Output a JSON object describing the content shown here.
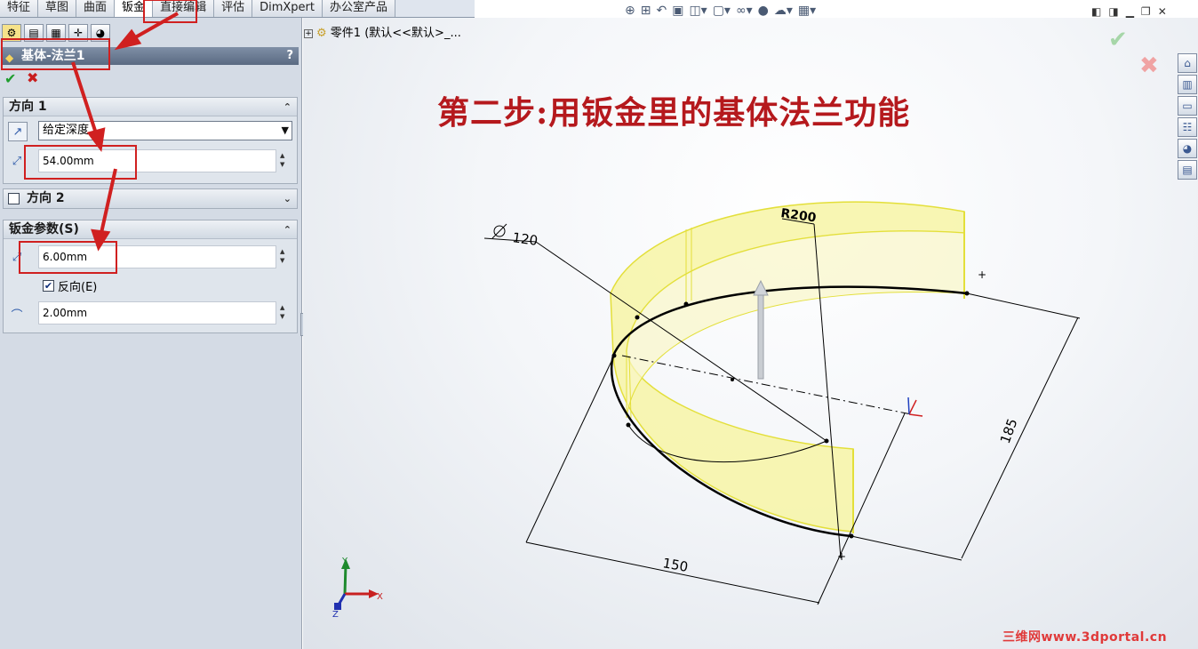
{
  "tabs": [
    "特征",
    "草图",
    "曲面",
    "钣金",
    "直接编辑",
    "评估",
    "DimXpert",
    "办公室产品"
  ],
  "active_tab": "钣金",
  "property_manager": {
    "title": "基体-法兰1",
    "help": "?",
    "ok": "✔",
    "cancel": "✖",
    "direction1": {
      "header": "方向 1",
      "end_condition": "给定深度",
      "depth": "54.00mm"
    },
    "direction2": {
      "header": "方向 2"
    },
    "sheet_metal": {
      "header": "钣金参数(S)",
      "thickness": "6.00mm",
      "reverse_label": "反向(E)",
      "bend_radius": "2.00mm"
    }
  },
  "feature_tree": {
    "root": "零件1 (默认<<默认>_..."
  },
  "annotation": "第二步:用钣金里的基体法兰功能",
  "dimensions": {
    "diameter": "120",
    "radius": "R200",
    "d185": "185",
    "d150": "150"
  },
  "triad": {
    "x": "X",
    "y": "Y",
    "z": "Z"
  },
  "watermark": "三维网www.3dportal.cn",
  "colors": {
    "annotation": "#b5191d",
    "arrow": "#d02020",
    "highlight_box": "#d02020",
    "flange_fill": "#f6f3a0",
    "flange_edge": "#e6e23a"
  }
}
